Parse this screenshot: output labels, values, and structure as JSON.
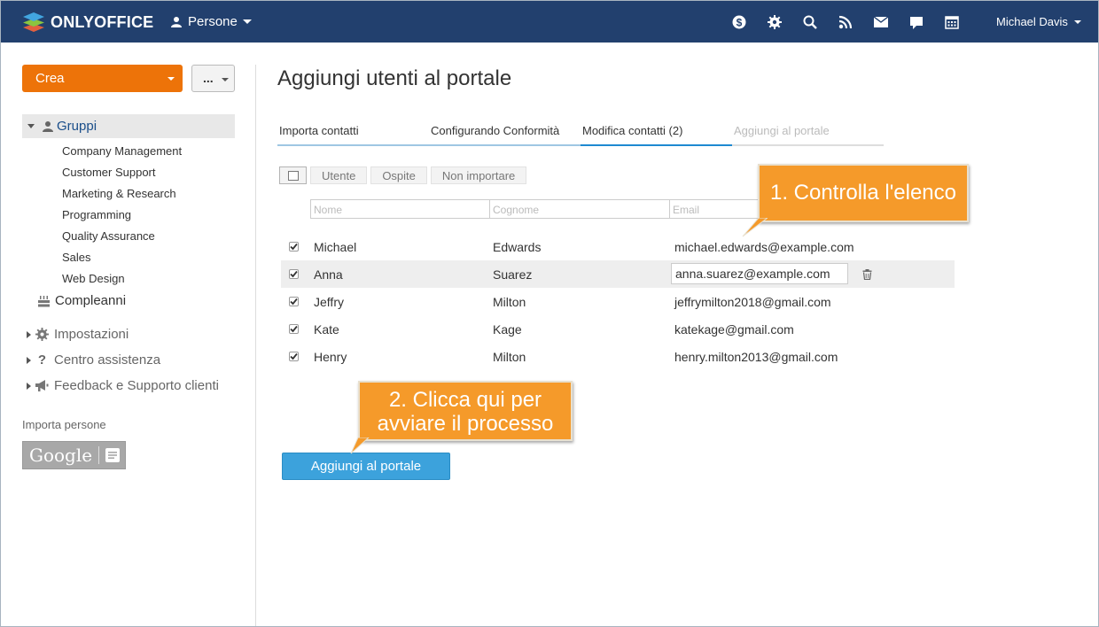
{
  "header": {
    "logo_text": "ONLYOFFICE",
    "module": "Persone",
    "user_name": "Michael Davis",
    "icons": [
      "dollar-icon",
      "gear-icon",
      "search-icon",
      "feed-icon",
      "mail-icon",
      "chat-icon",
      "calendar-icon"
    ]
  },
  "sidebar": {
    "create_label": "Crea",
    "more_label": "...",
    "groups_label": "Gruppi",
    "groups": [
      "Company Management",
      "Customer Support",
      "Marketing & Research",
      "Programming",
      "Quality Assurance",
      "Sales",
      "Web Design"
    ],
    "birthdays_label": "Compleanni",
    "settings_label": "Impostazioni",
    "help_label": "Centro assistenza",
    "feedback_label": "Feedback e Supporto clienti",
    "import_label": "Importa persone",
    "google_label": "Google"
  },
  "main": {
    "title": "Aggiungi utenti al portale",
    "steps": [
      {
        "label": "Importa contatti",
        "state": "done"
      },
      {
        "label": "Configurando Conformità",
        "state": "done"
      },
      {
        "label": "Modifica contatti (2)",
        "state": "active"
      },
      {
        "label": "Aggiungi al portale",
        "state": "disabled"
      }
    ],
    "toolbar": {
      "user": "Utente",
      "guest": "Ospite",
      "skip": "Non importare"
    },
    "filters": {
      "first": "Nome",
      "last": "Cognome",
      "email": "Email"
    },
    "contacts": [
      {
        "first": "Michael",
        "last": "Edwards",
        "email": "michael.edwards@example.com",
        "checked": true
      },
      {
        "first": "Anna",
        "last": "Suarez",
        "email": "anna.suarez@example.com",
        "checked": true,
        "editing": true
      },
      {
        "first": "Jeffry",
        "last": "Milton",
        "email": "jeffrymilton2018@gmail.com",
        "checked": true
      },
      {
        "first": "Kate",
        "last": "Kage",
        "email": "katekage@gmail.com",
        "checked": true
      },
      {
        "first": "Henry",
        "last": "Milton",
        "email": "henry.milton2013@gmail.com",
        "checked": true
      }
    ],
    "add_button": "Aggiungi al portale"
  },
  "callouts": {
    "one": "1. Controlla l'elenco",
    "two_line1": "2. Clicca qui per",
    "two_line2": "avviare il processo"
  },
  "colors": {
    "header_bg": "#22406e",
    "accent_orange": "#ed7309",
    "button_blue": "#3ca2dc",
    "callout": "#f59a2a"
  }
}
